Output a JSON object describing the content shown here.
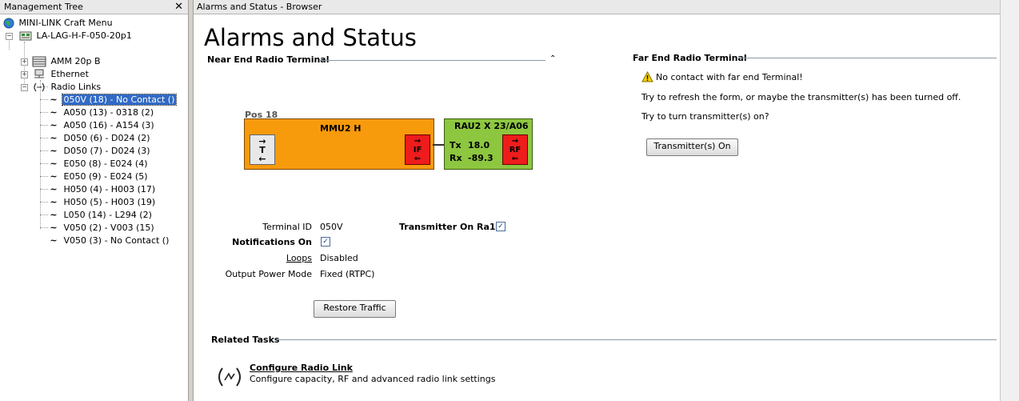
{
  "left_pane": {
    "title": "Management Tree",
    "close_glyph": "✕",
    "tree": [
      {
        "label": "MINI-LINK Craft Menu",
        "icon": "globe-icon"
      },
      {
        "label": "LA-LAG-H-F-050-20p1",
        "icon": "network-element-icon",
        "expander": "−"
      },
      {
        "label": "AMM 20p B",
        "icon": "rack-icon",
        "expander": "+"
      },
      {
        "label": "Ethernet",
        "icon": "ethernet-icon",
        "expander": "+"
      },
      {
        "label": "Radio Links",
        "icon": "radio-links-icon",
        "expander": "−"
      },
      {
        "label": "050V (18) - No Contact ()",
        "selected": true
      },
      {
        "label": "A050 (13) - 0318 (2)"
      },
      {
        "label": "A050 (16) - A154 (3)"
      },
      {
        "label": "D050 (6) - D024 (2)"
      },
      {
        "label": "D050 (7) - D024 (3)"
      },
      {
        "label": "E050 (8) - E024 (4)"
      },
      {
        "label": "E050 (9) - E024 (5)"
      },
      {
        "label": "H050 (4) - H003 (17)"
      },
      {
        "label": "H050 (5) - H003 (19)"
      },
      {
        "label": "L050 (14) - L294 (2)"
      },
      {
        "label": "V050 (2) - V003 (15)"
      },
      {
        "label": "V050 (3) - No Contact ()"
      }
    ]
  },
  "browser": {
    "title": "Alarms and Status - Browser",
    "page_title": "Alarms and Status"
  },
  "near_end": {
    "heading": "Near End Radio Terminal",
    "collapse_glyph": "⌃",
    "diagram": {
      "pos_label": "Pos 18",
      "mmu_label": "MMU2 H",
      "t_label": "T",
      "if_label": "IF",
      "rau_label": "RAU2 X 23/A06",
      "tx_label": "Tx",
      "tx_value": "18.0",
      "rx_label": "Rx",
      "rx_value": "-89.3",
      "rf_label": "RF"
    },
    "terminal_id_label": "Terminal ID",
    "terminal_id_value": "050V",
    "transmitter_on_label": "Transmitter On Ra1",
    "transmitter_on_checked": true,
    "notifications_label": "Notifications On",
    "notifications_checked": true,
    "loops_label": "Loops",
    "loops_value": "Disabled",
    "output_power_label": "Output Power Mode",
    "output_power_value": "Fixed (RTPC)",
    "restore_button": "Restore Traffic"
  },
  "far_end": {
    "heading": "Far End Radio Terminal",
    "warning": "No contact with far end Terminal!",
    "hint1": "Try to refresh the form, or maybe the transmitter(s) has been turned off.",
    "hint2": "Try to turn transmitter(s) on?",
    "button": "Transmitter(s) On"
  },
  "related_tasks": {
    "heading": "Related Tasks",
    "task_title": "Configure Radio Link",
    "task_desc": "Configure capacity, RF and advanced radio link settings"
  },
  "colors": {
    "mmu": "#f79a0c",
    "rau": "#8dc63f",
    "alarm": "#ee1c1c",
    "selection": "#316ac5"
  }
}
